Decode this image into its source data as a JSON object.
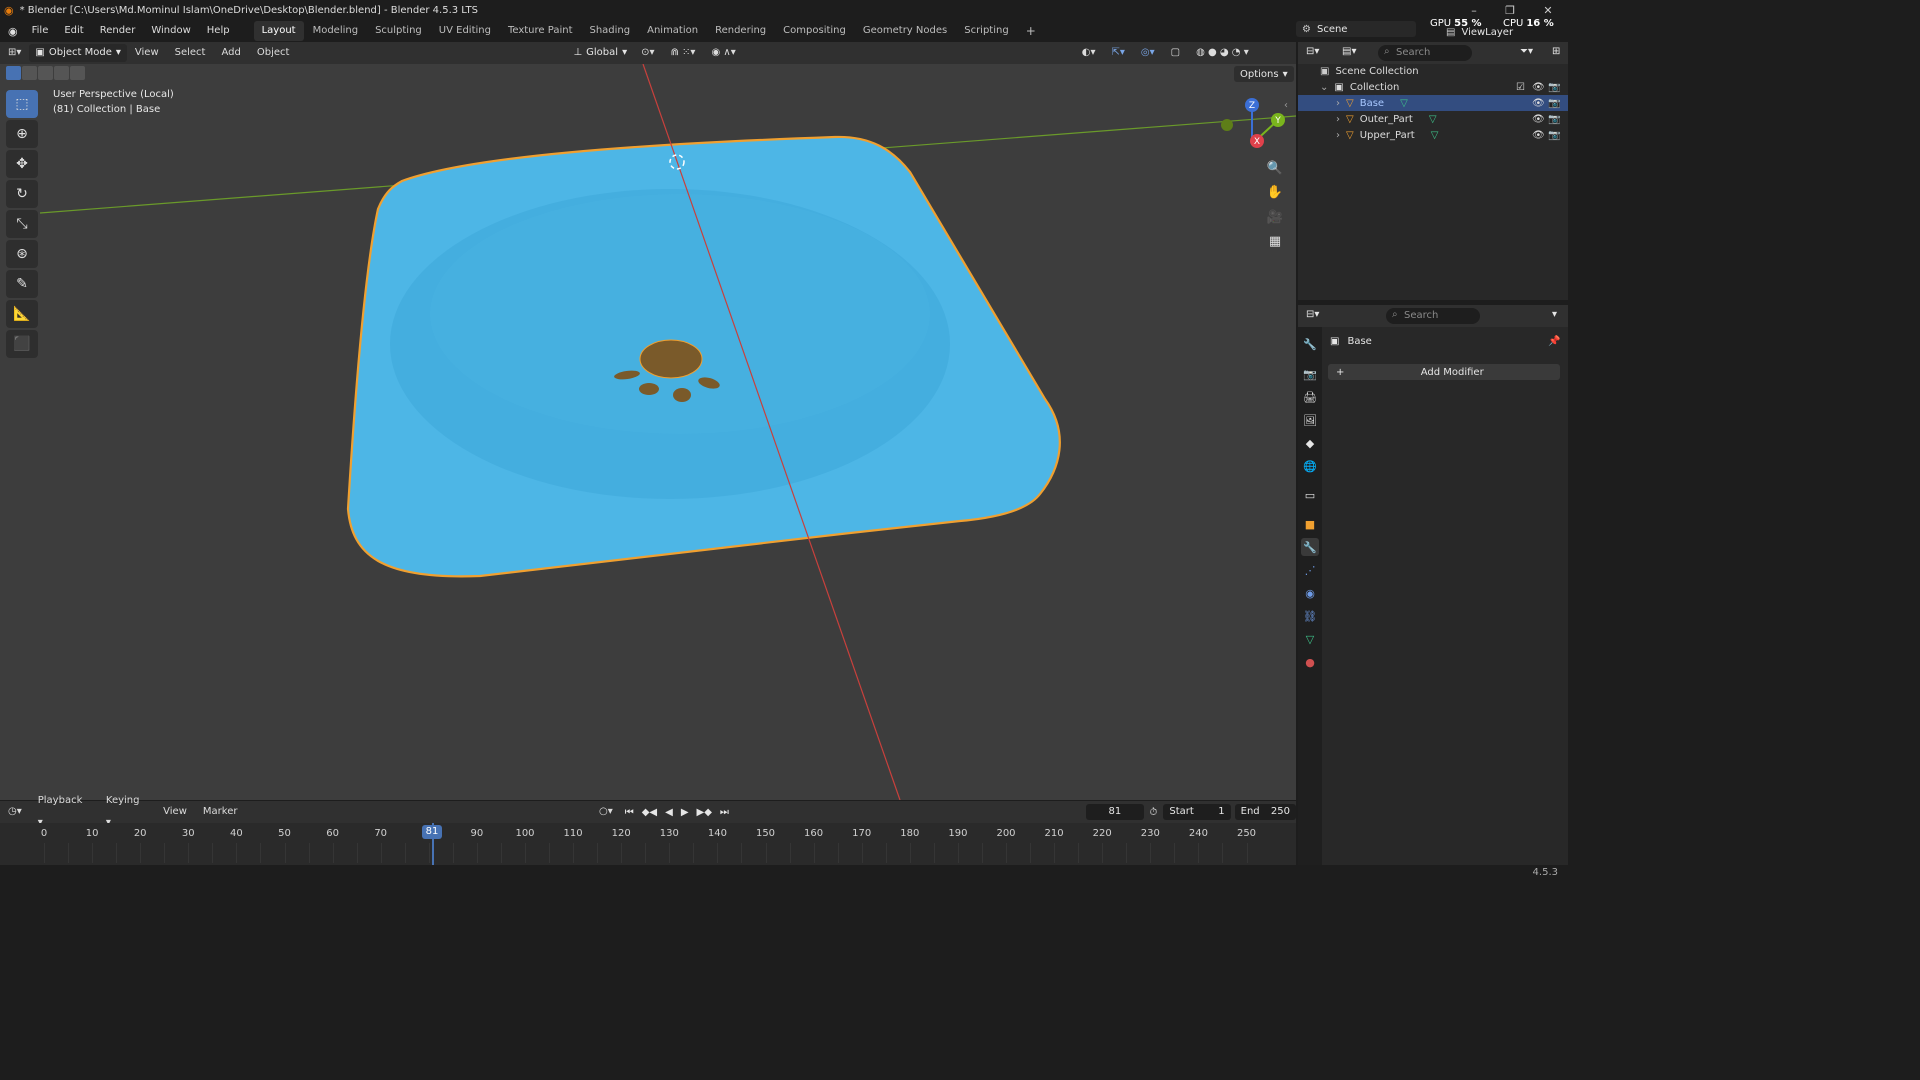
{
  "window": {
    "title": "* Blender [C:\\Users\\Md.Mominul Islam\\OneDrive\\Desktop\\Blender.blend] - Blender 4.5.3 LTS",
    "minimize": "–",
    "maximize": "❐",
    "close": "✕"
  },
  "menu": [
    "File",
    "Edit",
    "Render",
    "Window",
    "Help"
  ],
  "workspaces": [
    "Layout",
    "Modeling",
    "Sculpting",
    "UV Editing",
    "Texture Paint",
    "Shading",
    "Animation",
    "Rendering",
    "Compositing",
    "Geometry Nodes",
    "Scripting"
  ],
  "workspace_add": "+",
  "scene": {
    "label": "Scene",
    "view_layer": "ViewLayer"
  },
  "stats": {
    "gpu_label": "GPU",
    "gpu_value": "55 %",
    "cpu_label": "CPU",
    "cpu_value": "16 %"
  },
  "viewport_header": {
    "mode": "Object Mode",
    "menus": [
      "View",
      "Select",
      "Add",
      "Object"
    ],
    "orientation": "Global",
    "options": "Options"
  },
  "viewport": {
    "perspective": "User Perspective (Local)",
    "context": "(81) Collection | Base",
    "gizmo": {
      "z": "Z",
      "y": "Y",
      "x": "X"
    }
  },
  "timeline": {
    "menus": [
      "Playback",
      "Keying",
      "View",
      "Marker"
    ],
    "current_frame": "81",
    "start_label": "Start",
    "start": "1",
    "end_label": "End",
    "end": "250",
    "ticks": [
      "0",
      "10",
      "20",
      "30",
      "40",
      "50",
      "60",
      "70",
      "90",
      "100",
      "110",
      "120",
      "130",
      "140",
      "150",
      "160",
      "170",
      "180",
      "190",
      "200",
      "210",
      "220",
      "230",
      "240",
      "250"
    ]
  },
  "outliner": {
    "search_placeholder": "Search",
    "scene_collection": "Scene Collection",
    "collection": "Collection",
    "objects": [
      "Base",
      "Outer_Part",
      "Upper_Part"
    ]
  },
  "properties": {
    "search_placeholder": "Search",
    "object_name": "Base",
    "add_modifier": "Add Modifier"
  },
  "version": "4.5.3",
  "colors": {
    "accent": "#4772b3",
    "mesh": "#4db6e6",
    "selection_outline": "#f0a030",
    "x_axis": "#c8403c",
    "y_axis": "#6a9a2a"
  }
}
